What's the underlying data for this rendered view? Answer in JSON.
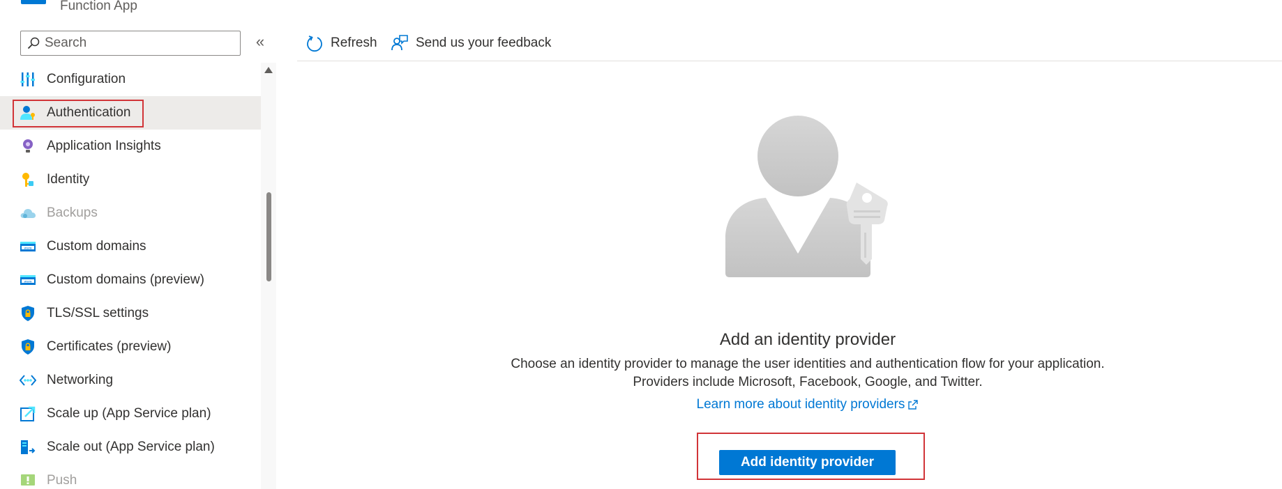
{
  "app": {
    "subtitle": "Function App"
  },
  "search": {
    "placeholder": "Search"
  },
  "collapse": {
    "glyph": "«"
  },
  "nav": {
    "items": [
      {
        "label": "Configuration",
        "icon": "configuration-icon"
      },
      {
        "label": "Authentication",
        "icon": "authentication-icon",
        "active": true
      },
      {
        "label": "Application Insights",
        "icon": "application-insights-icon"
      },
      {
        "label": "Identity",
        "icon": "identity-icon"
      },
      {
        "label": "Backups",
        "icon": "backups-icon",
        "disabled": true
      },
      {
        "label": "Custom domains",
        "icon": "custom-domains-icon"
      },
      {
        "label": "Custom domains (preview)",
        "icon": "custom-domains-icon"
      },
      {
        "label": "TLS/SSL settings",
        "icon": "shield-lock-icon"
      },
      {
        "label": "Certificates (preview)",
        "icon": "shield-lock-icon"
      },
      {
        "label": "Networking",
        "icon": "networking-icon"
      },
      {
        "label": "Scale up (App Service plan)",
        "icon": "scale-up-icon"
      },
      {
        "label": "Scale out (App Service plan)",
        "icon": "scale-out-icon"
      },
      {
        "label": "Push",
        "icon": "push-icon",
        "disabled": true
      }
    ]
  },
  "toolbar": {
    "refresh_label": "Refresh",
    "feedback_label": "Send us your feedback"
  },
  "main": {
    "title": "Add an identity provider",
    "description_line1": "Choose an identity provider to manage the user identities and authentication flow for your application.",
    "description_line2": "Providers include Microsoft, Facebook, Google, and Twitter.",
    "learn_more": "Learn more about identity providers",
    "add_button": "Add identity provider"
  },
  "colors": {
    "accent": "#0078d4",
    "highlight": "#d13438",
    "active_bg": "#edebe9"
  }
}
